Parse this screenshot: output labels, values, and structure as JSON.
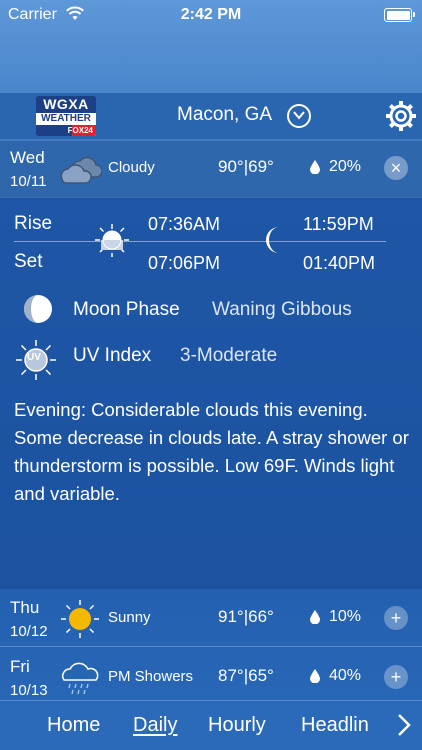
{
  "status_bar": {
    "carrier": "Carrier",
    "time": "2:42 PM"
  },
  "header": {
    "logo": {
      "line1": "WGXA",
      "line2": "WEATHER",
      "line3": "FOX24"
    },
    "city": "Macon, GA"
  },
  "days": [
    {
      "name": "Wed",
      "date": "10/11",
      "condition": "Cloudy",
      "temps": "90°|69°",
      "precip": "20%",
      "icon": "cloudy-icon",
      "expanded": true
    },
    {
      "name": "Thu",
      "date": "10/12",
      "condition": "Sunny",
      "temps": "91°|66°",
      "precip": "10%",
      "icon": "sun-icon",
      "expanded": false
    },
    {
      "name": "Fri",
      "date": "10/13",
      "condition": "PM Showers",
      "temps": "87°|65°",
      "precip": "40%",
      "icon": "rain-cloud-icon",
      "expanded": false
    }
  ],
  "details": {
    "rise_label": "Rise",
    "set_label": "Set",
    "sunrise": "07:36AM",
    "sunset": "07:06PM",
    "moonrise": "11:59PM",
    "moonset": "01:40PM",
    "moon_phase_label": "Moon Phase",
    "moon_phase_value": "Waning Gibbous",
    "uv_label": "UV Index",
    "uv_value": "3-Moderate",
    "uv_icon_text": "UV",
    "description": "Evening: Considerable clouds this evening. Some decrease in clouds late. A stray shower or thunderstorm is possible. Low 69F. Winds light and variable."
  },
  "nav": {
    "tabs": [
      {
        "label": "Home",
        "active": false
      },
      {
        "label": "Daily",
        "active": true
      },
      {
        "label": "Hourly",
        "active": false
      },
      {
        "label": "Headlin",
        "active": false
      }
    ]
  },
  "toggle_glyphs": {
    "collapse": "×",
    "expand": "+"
  },
  "colors": {
    "background_top": "#5e98d8",
    "panel": "#1e57a6",
    "sun": "#f5b800"
  }
}
